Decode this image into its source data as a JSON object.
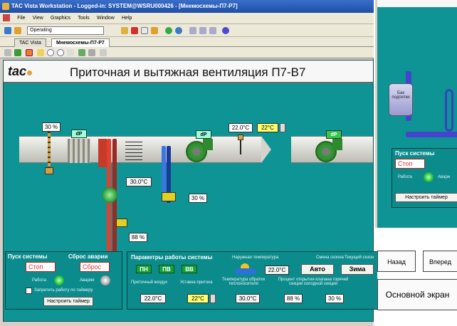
{
  "window": {
    "title": "TAC Vista Workstation - Logged-in: SYSTEM@WSRU000426 - [Мнемосхемы-П7-Р7]"
  },
  "menu": [
    "File",
    "View",
    "Graphics",
    "Tools",
    "Window",
    "Help"
  ],
  "toolbar": {
    "mode_value": "Operating"
  },
  "tabs": [
    {
      "label": "TAC Vista",
      "active": false
    },
    {
      "label": "Мнемосхемы-П7-Р7",
      "active": true
    }
  ],
  "header": {
    "logo": "tac",
    "title": "Приточная и вытяжная вентиляция П7-В7"
  },
  "diagram": {
    "damper_pct": "30 %",
    "dp1": "dP",
    "dp2": "dP",
    "dp3": "dP",
    "supply_temp": "22.0°C",
    "supply_setpoint": "22°C",
    "heater_temp": "30.0°C",
    "heater_valve_pct": "30 %",
    "cooler_valve_pct": "88 %"
  },
  "system_panel": {
    "title": "Пуск системы",
    "start_value": "Стоп",
    "reset_title": "Сброс аварии",
    "reset_value": "Сброс",
    "work_label": "Работа",
    "alarm_label": "Авария",
    "timer_check_label": "Запретить работу по таймеру",
    "timer_button": "Настроить таймер"
  },
  "params_panel": {
    "title": "Параметры работы системы",
    "outdoor_label": "Наружная температура",
    "season_label": "Смена сезона",
    "current_season_label": "Текущий сезон",
    "units": [
      "ПН",
      "ПВ",
      "ВВ"
    ],
    "outdoor_temp": "22.0°C",
    "auto_button": "Авто",
    "winter_button": "Зима",
    "supply_air_label": "Приточный воздух",
    "setpoint_label": "Уставка притока",
    "return_water_label": "Температура обратки теплоносителя",
    "valve_open_label": "Процент открытия клапана горячей секции   холодной секции",
    "supply_air_value": "22.0°C",
    "setpoint_value": "22°C",
    "return_water_value": "30.0°C",
    "hot_valve_value": "88 %",
    "cold_valve_value": "30 %"
  },
  "nav": {
    "back": "Назад",
    "forward": "Вперед",
    "main": "Основной экран"
  },
  "right_window": {
    "tank_label": "Бак подпитки",
    "panel_title": "Пуск системы",
    "start_value": "Стоп",
    "work_label": "Работа",
    "alarm_label": "Авари",
    "timer_button": "Настроить таймер"
  }
}
